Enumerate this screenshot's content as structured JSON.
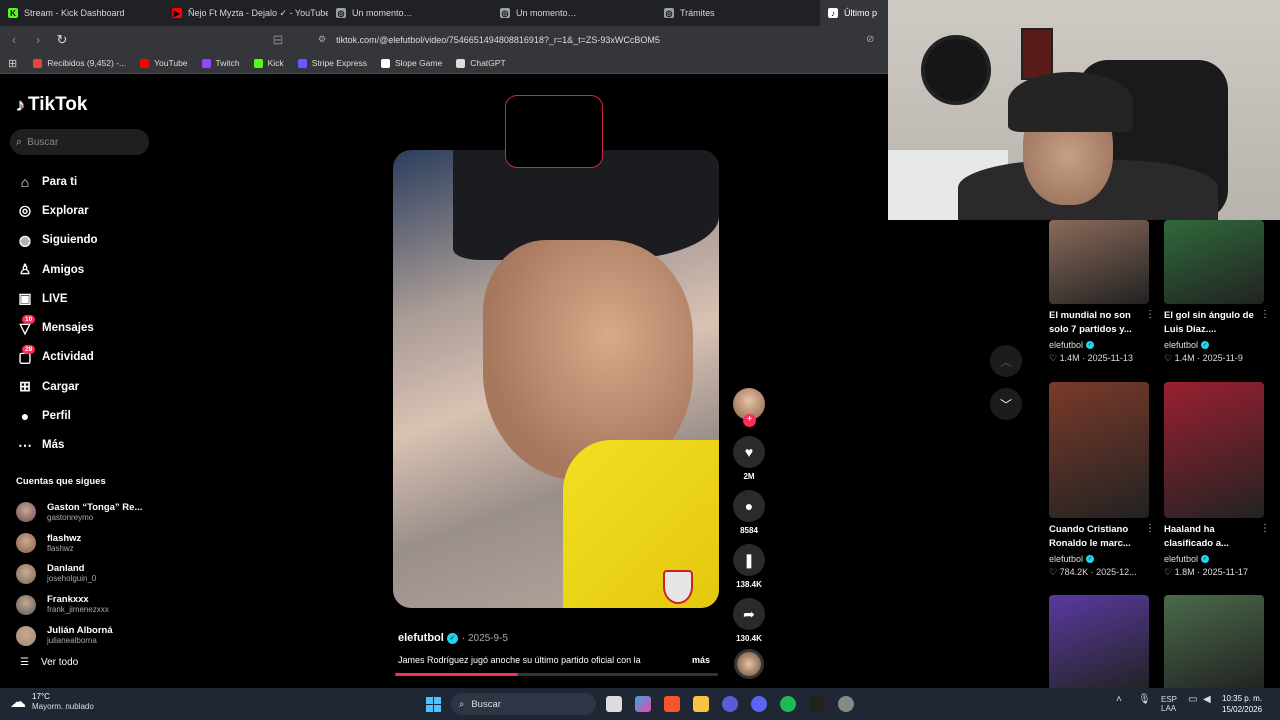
{
  "tabs": [
    {
      "label": "Stream - Kick Dashboard",
      "fav_color": "#53fc18",
      "fav_glyph": "K"
    },
    {
      "label": "Ñejo Ft Myzta - Dejalo ✓ - YouTube",
      "fav_color": "#ff0000",
      "fav_glyph": "▶"
    },
    {
      "label": "Un momento…",
      "fav_color": "#9aa0a6",
      "fav_glyph": "◎"
    },
    {
      "label": "Un momento…",
      "fav_color": "#9aa0a6",
      "fav_glyph": "◎"
    },
    {
      "label": "Trámites",
      "fav_color": "#9aa0a6",
      "fav_glyph": "◎"
    },
    {
      "label": "Último p",
      "fav_color": "#ffffff",
      "fav_glyph": "♪"
    }
  ],
  "address": {
    "url": "tiktok.com/@elefutbol/video/7546651494808816918?_r=1&_t=ZS-93xWCcBOM5"
  },
  "bookmarks": [
    {
      "label": "Recibidos (9,452) -...",
      "color": "#ea4335"
    },
    {
      "label": "YouTube",
      "color": "#ff0000"
    },
    {
      "label": "Twitch",
      "color": "#9146ff"
    },
    {
      "label": "Kick",
      "color": "#53fc18"
    },
    {
      "label": "Stripe Express",
      "color": "#635bff"
    },
    {
      "label": "Slope Game",
      "color": "#ffffff"
    },
    {
      "label": "ChatGPT",
      "color": "#dddddd"
    }
  ],
  "tiktok": {
    "logo": "TikTok",
    "search_placeholder": "Buscar",
    "nav": [
      {
        "label": "Para ti",
        "icon": "home-icon",
        "glyph": "⌂"
      },
      {
        "label": "Explorar",
        "icon": "compass-icon",
        "glyph": "◎"
      },
      {
        "label": "Siguiendo",
        "icon": "following-icon",
        "glyph": "◍"
      },
      {
        "label": "Amigos",
        "icon": "friends-icon",
        "glyph": "♙"
      },
      {
        "label": "LIVE",
        "icon": "live-icon",
        "glyph": "▣"
      },
      {
        "label": "Mensajes",
        "icon": "messages-icon",
        "glyph": "▽",
        "badge": "10"
      },
      {
        "label": "Actividad",
        "icon": "activity-icon",
        "glyph": "▢",
        "badge": "28"
      },
      {
        "label": "Cargar",
        "icon": "upload-icon",
        "glyph": "⊞"
      },
      {
        "label": "Perfil",
        "icon": "profile-icon",
        "glyph": "●"
      },
      {
        "label": "Más",
        "icon": "more-icon",
        "glyph": "⋯"
      }
    ],
    "following_heading": "Cuentas que sigues",
    "following": [
      {
        "name": "Gaston “Tonga” Re...",
        "user": "gastonreymo",
        "color": "#6a4a5a"
      },
      {
        "name": "flashwz",
        "user": "flashwz",
        "color": "#8a5a4a"
      },
      {
        "name": "Danland",
        "user": "joseholguin_0",
        "color": "#7a6a5a"
      },
      {
        "name": "Frankxxx",
        "user": "frank_jimenezxxx",
        "color": "#5a5a5a"
      },
      {
        "name": "Julián Alborná",
        "user": "julianealborna",
        "color": "#9a8a7a"
      }
    ],
    "see_all": "Ver todo"
  },
  "video": {
    "author": "elefutbol",
    "date": "· 2025-9-5",
    "caption": "James Rodríguez jugó anoche su último partido oficial con la",
    "more": "más",
    "progress": 0.38,
    "likes": "2M",
    "comments": "8584",
    "saves": "138.4K",
    "shares": "130.4K"
  },
  "recommendations": [
    {
      "title": "El mundial no son solo 7 partidos y...",
      "author": "elefutbol",
      "likes": "♡ 1.4M",
      "date": "2025-11-13",
      "bg": "#8a6a5a"
    },
    {
      "title": "El gol sin ángulo de Luis Díaz....",
      "author": "elefutbol",
      "likes": "♡ 1.4M",
      "date": "2025-11-9",
      "bg": "#2f6a3a"
    },
    {
      "title": "Cuando Cristiano Ronaldo le marc...",
      "author": "elefutbol",
      "likes": "♡ 784.2K",
      "date": "2025-12...",
      "bg": "#7a3a2a"
    },
    {
      "title": "Haaland ha clasificado a...",
      "author": "elefutbol",
      "likes": "♡ 1.8M",
      "date": "2025-11-17",
      "bg": "#9a2030"
    },
    {
      "title": "",
      "author": "",
      "likes": "",
      "date": "",
      "bg": "#5a3aa0"
    },
    {
      "title": "",
      "author": "",
      "likes": "",
      "date": "",
      "bg": "#4a6a4a"
    }
  ],
  "taskbar": {
    "temp": "17°C",
    "weather": "Mayorm. nublado",
    "search": "Buscar",
    "lang1": "ESP",
    "lang2": "LAA",
    "time": "10:35 p. m.",
    "date": "15/02/2026"
  }
}
